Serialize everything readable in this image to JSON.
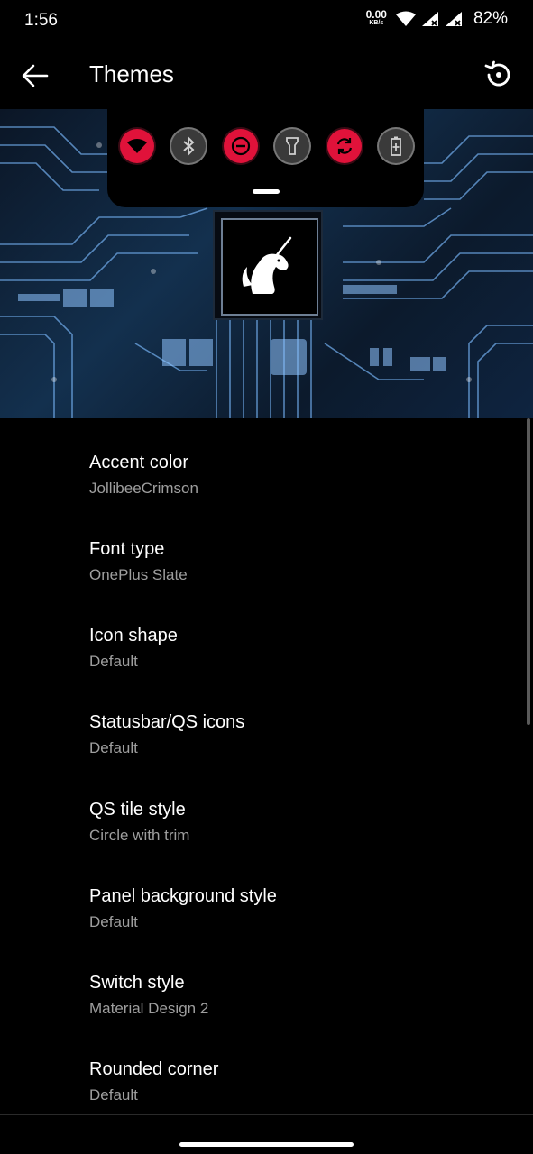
{
  "status_bar": {
    "time": "1:56",
    "net_speed_value": "0.00",
    "net_speed_unit": "KB/s",
    "battery": "82%",
    "icons": [
      "wifi-icon",
      "signal-x-icon",
      "signal-x-icon"
    ]
  },
  "app_bar": {
    "title": "Themes",
    "back_icon": "arrow-left-icon",
    "action_icon": "restore-icon"
  },
  "preview": {
    "quick_settings": [
      {
        "name": "wifi",
        "color": "#e0123a",
        "icon": "wifi-icon"
      },
      {
        "name": "bluetooth",
        "color": "#3a3a3a",
        "icon": "bluetooth-icon"
      },
      {
        "name": "do-not-disturb",
        "color": "#e0123a",
        "icon": "minus-circle-icon"
      },
      {
        "name": "flashlight",
        "color": "#3a3a3a",
        "icon": "flashlight-icon"
      },
      {
        "name": "auto-rotate",
        "color": "#e0123a",
        "icon": "rotate-icon"
      },
      {
        "name": "battery-saver",
        "color": "#3a3a3a",
        "icon": "battery-icon"
      }
    ],
    "logo_icon": "unicorn-icon",
    "accent": "#e0123a"
  },
  "settings": [
    {
      "title": "Accent color",
      "value": "JollibeeCrimson"
    },
    {
      "title": "Font type",
      "value": "OnePlus Slate"
    },
    {
      "title": "Icon shape",
      "value": "Default"
    },
    {
      "title": "Statusbar/QS icons",
      "value": "Default"
    },
    {
      "title": "QS tile style",
      "value": "Circle with trim"
    },
    {
      "title": "Panel background style",
      "value": "Default"
    },
    {
      "title": "Switch style",
      "value": "Material Design 2"
    },
    {
      "title": "Rounded corner",
      "value": "Default"
    }
  ]
}
